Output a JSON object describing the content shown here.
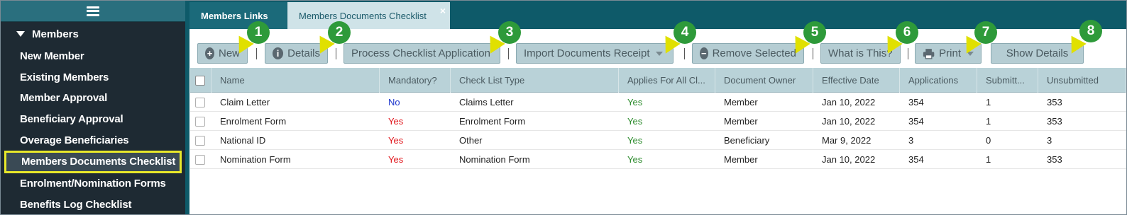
{
  "sidebar": {
    "section_label": "Members",
    "items": [
      {
        "label": "New Member"
      },
      {
        "label": "Existing Members"
      },
      {
        "label": "Member Approval"
      },
      {
        "label": "Beneficiary Approval"
      },
      {
        "label": "Overage Beneficiaries"
      },
      {
        "label": "Members Documents Checklist"
      },
      {
        "label": "Enrolment/Nomination Forms"
      },
      {
        "label": "Benefits Log Checklist"
      }
    ]
  },
  "tabs": {
    "members_links": "Members Links",
    "checklist": "Members Documents Checklist",
    "close_glyph": "×"
  },
  "toolbar": {
    "new_label": "New",
    "details_label": "Details",
    "process_label": "Process Checklist Application",
    "import_label": "Import Documents Receipt",
    "remove_label": "Remove Selected",
    "what_label": "What is This?",
    "print_label": "Print",
    "show_details_label": "Show Details",
    "badges": [
      "1",
      "2",
      "3",
      "4",
      "5",
      "6",
      "7",
      "8"
    ]
  },
  "grid": {
    "columns": [
      "Name",
      "Mandatory?",
      "Check List Type",
      "Applies For All Cl...",
      "Document Owner",
      "Effective Date",
      "Applications",
      "Submitt...",
      "Unsubmitted"
    ],
    "rows": [
      {
        "name": "Claim Letter",
        "mandatory": "No",
        "type": "Claims Letter",
        "applies": "Yes",
        "owner": "Member",
        "date": "Jan 10, 2022",
        "applications": "354",
        "submitted": "1",
        "unsubmitted": "353"
      },
      {
        "name": "Enrolment Form",
        "mandatory": "Yes",
        "type": "Enrolment Form",
        "applies": "Yes",
        "owner": "Member",
        "date": "Jan 10, 2022",
        "applications": "354",
        "submitted": "1",
        "unsubmitted": "353"
      },
      {
        "name": "National ID",
        "mandatory": "Yes",
        "type": "Other",
        "applies": "Yes",
        "owner": "Beneficiary",
        "date": "Mar 9, 2022",
        "applications": "3",
        "submitted": "0",
        "unsubmitted": "3"
      },
      {
        "name": "Nomination Form",
        "mandatory": "Yes",
        "type": "Nomination Form",
        "applies": "Yes",
        "owner": "Member",
        "date": "Jan 10, 2022",
        "applications": "354",
        "submitted": "1",
        "unsubmitted": "353"
      }
    ]
  },
  "colors": {
    "sidebar_bg": "#1e2a33",
    "accent_teal": "#0e5a69",
    "highlight_yellow": "#e8e82a",
    "badge_green": "#2e9a3a",
    "no_blue": "#1a33cc",
    "yes_red": "#e0141a",
    "yes_green": "#2a8a2a"
  },
  "icons": [
    "menu-icon",
    "caret-down-icon",
    "plus-circle-icon",
    "info-circle-icon",
    "minus-circle-icon",
    "printer-icon",
    "close-icon"
  ]
}
